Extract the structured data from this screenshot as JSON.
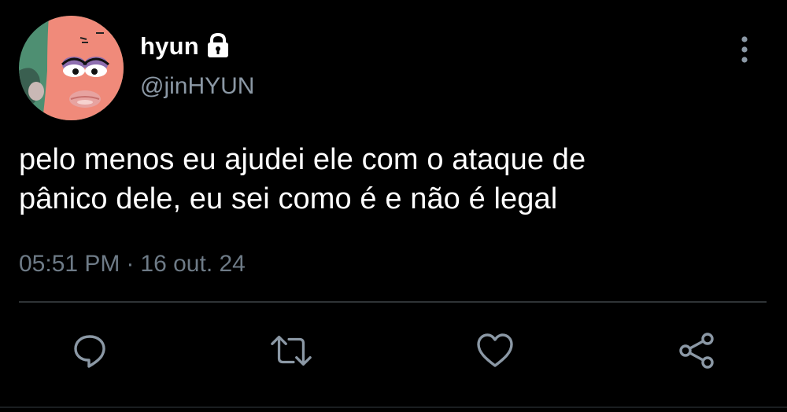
{
  "user": {
    "display_name": "hyun",
    "handle": "@jinHYUN",
    "protected_icon": "lock-icon",
    "avatar": "profile-avatar"
  },
  "tweet": {
    "text_line1": "pelo menos eu ajudei ele com o ataque de",
    "text_line2": "pânico dele, eu sei como é e não é legal",
    "time": "05:51 PM",
    "separator": "·",
    "date": "16 out. 24"
  },
  "actions": [
    {
      "icon": "reply-icon"
    },
    {
      "icon": "retweet-icon"
    },
    {
      "icon": "like-icon"
    },
    {
      "icon": "share-icon"
    }
  ],
  "menu": {
    "icon": "more-vertical-icon"
  },
  "colors": {
    "background": "#000000",
    "text_primary": "#ffffff",
    "text_secondary": "#8b98a5",
    "icon_gray": "#8b98a5",
    "divider": "#2f3336"
  }
}
